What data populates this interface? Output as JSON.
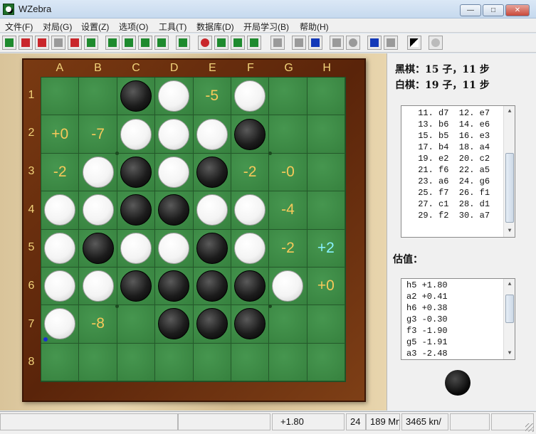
{
  "window": {
    "title": "WZebra"
  },
  "menu": [
    "文件(F)",
    "对局(G)",
    "设置(Z)",
    "选项(O)",
    "工具(T)",
    "数据库(D)",
    "开局学习(B)",
    "帮助(H)"
  ],
  "toolbar": {
    "icons": [
      "new-game-icon",
      "open-red-icon",
      "stack-icon",
      "gray-book-icon",
      "save-disk-icon",
      "open-folder-icon",
      "play-icon",
      "player-face-icon",
      "player-face-2-icon",
      "zz-icon",
      "download-icon",
      "stop-icon",
      "green-eval-icon",
      "green-eval-2-icon",
      "refresh-icon",
      "gray-square-icon",
      "first-move-icon",
      "back-icon",
      "down-icon",
      "hint-icon",
      "forward-icon",
      "last-move-icon",
      "flip-board-icon",
      "globe-icon"
    ],
    "colors": {
      "green": "#1e8a2e",
      "red": "#c9262b",
      "blue": "#1238b8",
      "gray": "#9a9a9a"
    }
  },
  "board": {
    "columns": [
      "A",
      "B",
      "C",
      "D",
      "E",
      "F",
      "G",
      "H"
    ],
    "rows": [
      "1",
      "2",
      "3",
      "4",
      "5",
      "6",
      "7",
      "8"
    ],
    "cells": [
      [
        "",
        "",
        "B",
        "W",
        "-5",
        "W",
        "",
        ""
      ],
      [
        "+0",
        "-7",
        "W",
        "W",
        "W",
        "B",
        "",
        ""
      ],
      [
        "-2",
        "W",
        "B",
        "W",
        "B",
        "-2",
        "-0",
        ""
      ],
      [
        "W",
        "W",
        "B",
        "B",
        "W",
        "W",
        "-4",
        ""
      ],
      [
        "W",
        "B",
        "W",
        "W",
        "B",
        "W",
        "-2",
        "+2*"
      ],
      [
        "W",
        "W",
        "B",
        "B",
        "B",
        "B",
        "W",
        "+0"
      ],
      [
        "W",
        "-8",
        "",
        "B",
        "B",
        "B",
        "",
        ""
      ],
      [
        "",
        "",
        "",
        "",
        "",
        "",
        "",
        ""
      ]
    ],
    "last_move_marker": "a7",
    "colors": {
      "board": "#3c8a45",
      "frame": "#6a2e0e",
      "label": "#f2d37a",
      "score": "#f6c95a",
      "best_score": "#88f2ff"
    }
  },
  "info": {
    "black": "黑棋：15 子，11 步",
    "white": "白棋：19 子，11 步"
  },
  "moves": [
    " 11. d7  12. e7",
    " 13. b6  14. e6",
    " 15. b5  16. e3",
    " 17. b4  18. a4",
    " 19. e2  20. c2",
    " 21. f6  22. a5",
    " 23. a6  24. g6",
    " 25. f7  26. f1",
    " 27. c1  28. d1",
    " 29. f2  30. a7"
  ],
  "eval_title": "估值：",
  "evals": [
    "h5 +1.80",
    "a2 +0.41",
    "h6 +0.38",
    "g3 -0.30",
    "f3 -1.90",
    "g5 -1.91",
    "a3 -2.48"
  ],
  "status": {
    "score": "+1.80",
    "depth": "24",
    "nodes": "189 Mn",
    "speed": "3465 kn/"
  }
}
